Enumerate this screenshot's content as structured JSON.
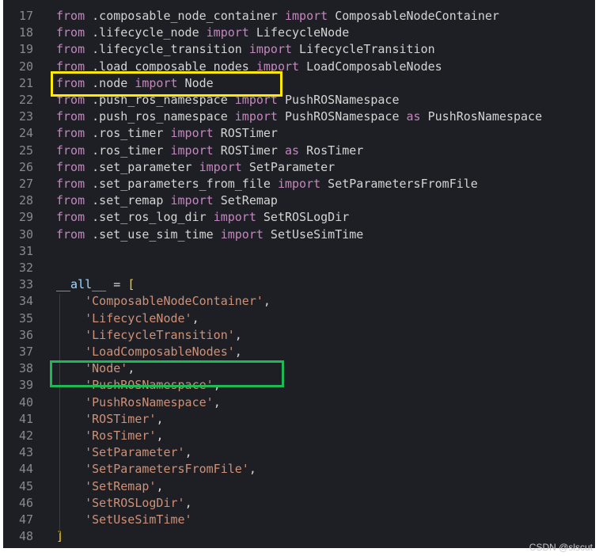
{
  "lines": [
    {
      "n": "17",
      "tokens": [
        [
          "kw",
          "from"
        ],
        [
          "plain",
          " .composable_node_container "
        ],
        [
          "kw",
          "import"
        ],
        [
          "plain",
          " ComposableNodeContainer"
        ]
      ]
    },
    {
      "n": "18",
      "tokens": [
        [
          "kw",
          "from"
        ],
        [
          "plain",
          " .lifecycle_node "
        ],
        [
          "kw",
          "import"
        ],
        [
          "plain",
          " LifecycleNode"
        ]
      ]
    },
    {
      "n": "19",
      "tokens": [
        [
          "kw",
          "from"
        ],
        [
          "plain",
          " .lifecycle_transition "
        ],
        [
          "kw",
          "import"
        ],
        [
          "plain",
          " LifecycleTransition"
        ]
      ]
    },
    {
      "n": "20",
      "tokens": [
        [
          "kw",
          "from"
        ],
        [
          "plain",
          " .load_composable_nodes "
        ],
        [
          "kw",
          "import"
        ],
        [
          "plain",
          " LoadComposableNodes"
        ]
      ]
    },
    {
      "n": "21",
      "tokens": [
        [
          "kw",
          "from"
        ],
        [
          "plain",
          " .node "
        ],
        [
          "kw",
          "import"
        ],
        [
          "plain",
          " Node"
        ]
      ]
    },
    {
      "n": "22",
      "tokens": [
        [
          "kw",
          "from"
        ],
        [
          "plain",
          " .push_ros_namespace "
        ],
        [
          "kw",
          "import"
        ],
        [
          "plain",
          " PushROSNamespace"
        ]
      ]
    },
    {
      "n": "23",
      "tokens": [
        [
          "kw",
          "from"
        ],
        [
          "plain",
          " .push_ros_namespace "
        ],
        [
          "kw",
          "import"
        ],
        [
          "plain",
          " PushROSNamespace "
        ],
        [
          "kw",
          "as"
        ],
        [
          "plain",
          " PushRosNamespace"
        ]
      ]
    },
    {
      "n": "24",
      "tokens": [
        [
          "kw",
          "from"
        ],
        [
          "plain",
          " .ros_timer "
        ],
        [
          "kw",
          "import"
        ],
        [
          "plain",
          " ROSTimer"
        ]
      ]
    },
    {
      "n": "25",
      "tokens": [
        [
          "kw",
          "from"
        ],
        [
          "plain",
          " .ros_timer "
        ],
        [
          "kw",
          "import"
        ],
        [
          "plain",
          " ROSTimer "
        ],
        [
          "kw",
          "as"
        ],
        [
          "plain",
          " RosTimer"
        ]
      ]
    },
    {
      "n": "26",
      "tokens": [
        [
          "kw",
          "from"
        ],
        [
          "plain",
          " .set_parameter "
        ],
        [
          "kw",
          "import"
        ],
        [
          "plain",
          " SetParameter"
        ]
      ]
    },
    {
      "n": "27",
      "tokens": [
        [
          "kw",
          "from"
        ],
        [
          "plain",
          " .set_parameters_from_file "
        ],
        [
          "kw",
          "import"
        ],
        [
          "plain",
          " SetParametersFromFile"
        ]
      ]
    },
    {
      "n": "28",
      "tokens": [
        [
          "kw",
          "from"
        ],
        [
          "plain",
          " .set_remap "
        ],
        [
          "kw",
          "import"
        ],
        [
          "plain",
          " SetRemap"
        ]
      ]
    },
    {
      "n": "29",
      "tokens": [
        [
          "kw",
          "from"
        ],
        [
          "plain",
          " .set_ros_log_dir "
        ],
        [
          "kw",
          "import"
        ],
        [
          "plain",
          " SetROSLogDir"
        ]
      ]
    },
    {
      "n": "30",
      "tokens": [
        [
          "kw",
          "from"
        ],
        [
          "plain",
          " .set_use_sim_time "
        ],
        [
          "kw",
          "import"
        ],
        [
          "plain",
          " SetUseSimTime"
        ]
      ]
    },
    {
      "n": "31",
      "tokens": []
    },
    {
      "n": "32",
      "tokens": []
    },
    {
      "n": "33",
      "tokens": [
        [
          "dunder",
          "__all__"
        ],
        [
          "plain",
          " = "
        ],
        [
          "bracket",
          "["
        ]
      ]
    },
    {
      "n": "34",
      "tokens": [
        [
          "plain",
          "    "
        ],
        [
          "str",
          "'ComposableNodeContainer'"
        ],
        [
          "plain",
          ","
        ]
      ]
    },
    {
      "n": "35",
      "tokens": [
        [
          "plain",
          "    "
        ],
        [
          "str",
          "'LifecycleNode'"
        ],
        [
          "plain",
          ","
        ]
      ]
    },
    {
      "n": "36",
      "tokens": [
        [
          "plain",
          "    "
        ],
        [
          "str",
          "'LifecycleTransition'"
        ],
        [
          "plain",
          ","
        ]
      ]
    },
    {
      "n": "37",
      "tokens": [
        [
          "plain",
          "    "
        ],
        [
          "str",
          "'LoadComposableNodes'"
        ],
        [
          "plain",
          ","
        ]
      ]
    },
    {
      "n": "38",
      "tokens": [
        [
          "plain",
          "    "
        ],
        [
          "str",
          "'Node'"
        ],
        [
          "plain",
          ","
        ]
      ]
    },
    {
      "n": "39",
      "tokens": [
        [
          "plain",
          "    "
        ],
        [
          "str",
          "'PushROSNamespace'"
        ],
        [
          "plain",
          ","
        ]
      ]
    },
    {
      "n": "40",
      "tokens": [
        [
          "plain",
          "    "
        ],
        [
          "str",
          "'PushRosNamespace'"
        ],
        [
          "plain",
          ","
        ]
      ]
    },
    {
      "n": "41",
      "tokens": [
        [
          "plain",
          "    "
        ],
        [
          "str",
          "'ROSTimer'"
        ],
        [
          "plain",
          ","
        ]
      ]
    },
    {
      "n": "42",
      "tokens": [
        [
          "plain",
          "    "
        ],
        [
          "str",
          "'RosTimer'"
        ],
        [
          "plain",
          ","
        ]
      ]
    },
    {
      "n": "43",
      "tokens": [
        [
          "plain",
          "    "
        ],
        [
          "str",
          "'SetParameter'"
        ],
        [
          "plain",
          ","
        ]
      ]
    },
    {
      "n": "44",
      "tokens": [
        [
          "plain",
          "    "
        ],
        [
          "str",
          "'SetParametersFromFile'"
        ],
        [
          "plain",
          ","
        ]
      ]
    },
    {
      "n": "45",
      "tokens": [
        [
          "plain",
          "    "
        ],
        [
          "str",
          "'SetRemap'"
        ],
        [
          "plain",
          ","
        ]
      ]
    },
    {
      "n": "46",
      "tokens": [
        [
          "plain",
          "    "
        ],
        [
          "str",
          "'SetROSLogDir'"
        ],
        [
          "plain",
          ","
        ]
      ]
    },
    {
      "n": "47",
      "tokens": [
        [
          "plain",
          "    "
        ],
        [
          "str",
          "'SetUseSimTime'"
        ]
      ]
    },
    {
      "n": "48",
      "tokens": [
        [
          "bracket",
          "]"
        ]
      ]
    }
  ],
  "watermark": "CSDN @slscut",
  "colors": {
    "background": "#1e1f24",
    "keyword": "#c586c0",
    "string": "#ce9178",
    "text": "#d4d4d4",
    "line_number": "#858a91",
    "highlight_import": "#ffea00",
    "highlight_all_entry": "#1db954"
  }
}
